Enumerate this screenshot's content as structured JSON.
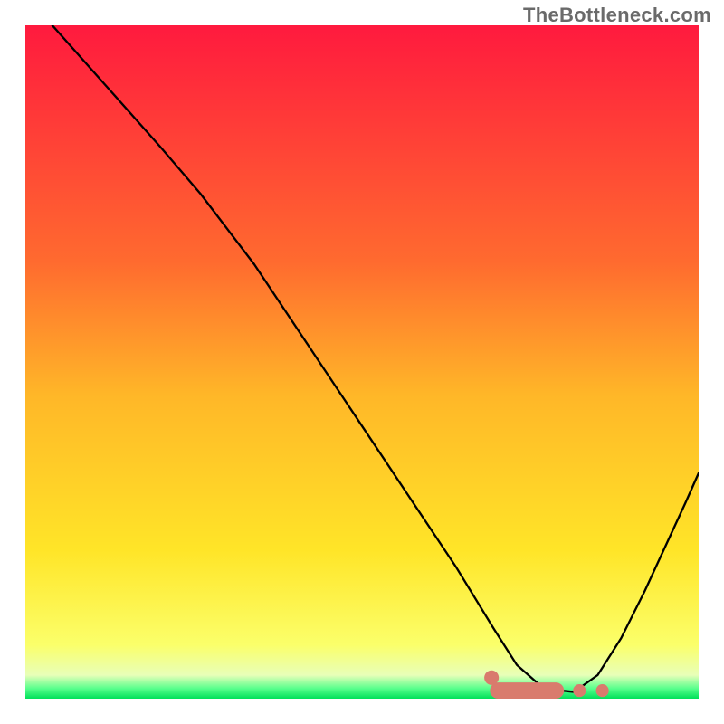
{
  "watermark": "TheBottleneck.com",
  "chart_data": {
    "type": "line",
    "title": "",
    "xlabel": "",
    "ylabel": "",
    "xlim": [
      0,
      100
    ],
    "ylim": [
      0,
      100
    ],
    "background_gradient": {
      "stops": [
        {
          "pos": 0.0,
          "color": "#ff1a3e"
        },
        {
          "pos": 0.35,
          "color": "#ff6a2f"
        },
        {
          "pos": 0.55,
          "color": "#ffb728"
        },
        {
          "pos": 0.78,
          "color": "#ffe528"
        },
        {
          "pos": 0.92,
          "color": "#fbff6a"
        },
        {
          "pos": 0.965,
          "color": "#e8ffb8"
        },
        {
          "pos": 0.985,
          "color": "#57ff8c"
        },
        {
          "pos": 1.0,
          "color": "#00e05a"
        }
      ]
    },
    "series": [
      {
        "name": "bottleneck-curve",
        "stroke": "#000000",
        "stroke_width": 2.3,
        "x": [
          4.0,
          12.0,
          20.0,
          26.0,
          34.0,
          42.0,
          50.0,
          58.0,
          64.0,
          69.5,
          73.0,
          77.0,
          81.5,
          85.0,
          88.5,
          92.0,
          95.0,
          98.0,
          100.0
        ],
        "y": [
          100.0,
          91.0,
          82.0,
          75.0,
          64.5,
          52.5,
          40.5,
          28.5,
          19.5,
          10.5,
          5.0,
          1.5,
          1.0,
          3.5,
          9.0,
          16.0,
          22.5,
          29.0,
          33.5
        ]
      }
    ],
    "marker_strip": {
      "name": "optimal-region",
      "fill": "#d97b6d",
      "y": 1.2,
      "segments": [
        {
          "shape": "round-bar",
          "x0": 69.0,
          "x1": 80.0,
          "r": 1.2
        },
        {
          "shape": "dot",
          "x": 82.3,
          "r": 0.95
        },
        {
          "shape": "dot",
          "x": 85.7,
          "r": 0.95
        }
      ]
    }
  }
}
